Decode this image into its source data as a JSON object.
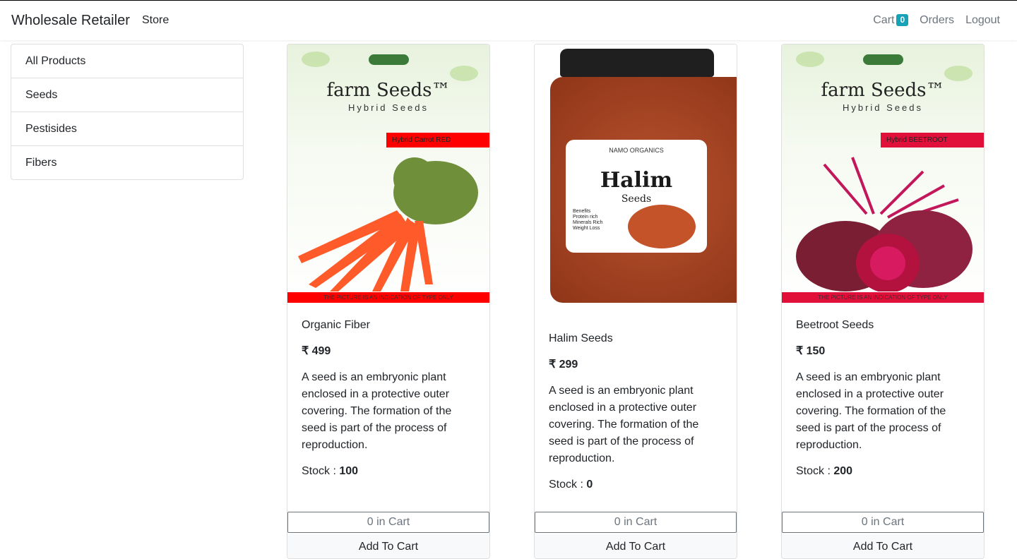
{
  "navbar": {
    "brand": "Wholesale Retailer",
    "store": "Store",
    "cart_label": "Cart",
    "cart_count": "0",
    "orders": "Orders",
    "logout": "Logout"
  },
  "sidebar": {
    "items": [
      {
        "label": "All Products"
      },
      {
        "label": "Seeds"
      },
      {
        "label": "Pestisides"
      },
      {
        "label": "Fibers"
      }
    ]
  },
  "currency_symbol": "₹",
  "stock_label": "Stock :",
  "products": [
    {
      "name": "Organic Fiber",
      "price": "₹ 499",
      "description": "A seed is an embryonic plant enclosed in a protective outer covering. The formation of the seed is part of the process of reproduction.",
      "stock": "100",
      "cart_count_text": "0 in Cart",
      "add_label": "Add To Cart",
      "image": {
        "logo": "farm Seeds™",
        "subtitle": "Hybrid Seeds",
        "band_text": "Hybrid Carrot RED",
        "footer_text": "THE PICTURE IS AN INDICATION OF TYPE ONLY",
        "band_color": "#ff0000"
      }
    },
    {
      "name": "Halim Seeds",
      "price": "₹ 299",
      "description": "A seed is an embryonic plant enclosed in a protective outer covering. The formation of the seed is part of the process of reproduction.",
      "stock": "0",
      "cart_count_text": "0 in Cart",
      "add_label": "Add To Cart",
      "image": {
        "brand": "NAMO ORGANICS",
        "title": "Halim",
        "subtitle": "Seeds",
        "benefits": "Benefits\nProtein rich\nMinerals Rich\nWeight Loss"
      }
    },
    {
      "name": "Beetroot Seeds",
      "price": "₹ 150",
      "description": "A seed is an embryonic plant enclosed in a protective outer covering. The formation of the seed is part of the process of reproduction.",
      "stock": "200",
      "cart_count_text": "0 in Cart",
      "add_label": "Add To Cart",
      "image": {
        "logo": "farm Seeds™",
        "subtitle": "Hybrid Seeds",
        "band_text": "Hybrid BEETROOT",
        "footer_text": "THE PICTURE IS AN INDICATION OF TYPE ONLY",
        "band_color": "#e0103a"
      }
    }
  ]
}
